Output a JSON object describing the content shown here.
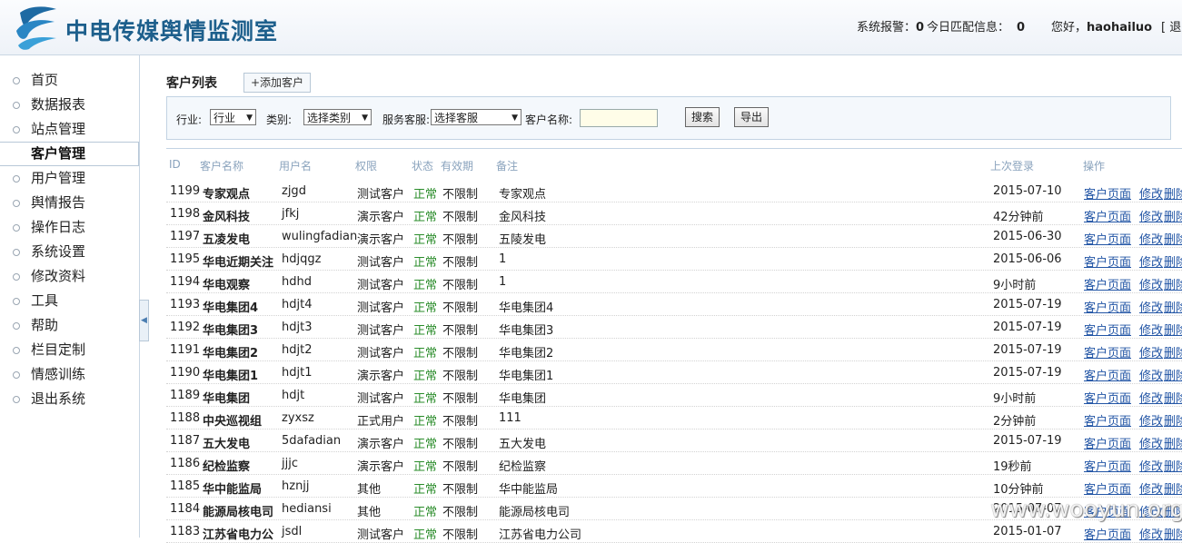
{
  "header": {
    "site_title": "中电传媒舆情监测室",
    "alarm_label": "系统报警：",
    "alarm_count": "0",
    "match_label": "今日匹配信息：",
    "match_count": "0",
    "greeting": "您好，",
    "username": "haohailuo",
    "logout_partial": "[ 退出"
  },
  "sidebar": {
    "items": [
      {
        "label": "首页"
      },
      {
        "label": "数据报表"
      },
      {
        "label": "站点管理"
      },
      {
        "label": "客户管理",
        "active": true
      },
      {
        "label": "用户管理"
      },
      {
        "label": "舆情报告"
      },
      {
        "label": "操作日志"
      },
      {
        "label": "系统设置"
      },
      {
        "label": "修改资料"
      },
      {
        "label": "工具"
      },
      {
        "label": "帮助"
      },
      {
        "label": "栏目定制"
      },
      {
        "label": "情感训练"
      },
      {
        "label": "退出系统"
      }
    ],
    "collapse_glyph": "◀"
  },
  "page": {
    "title": "客户列表",
    "add_button": "+添加客户"
  },
  "filter": {
    "industry_label": "行业:",
    "industry_value": "行业",
    "category_label": "类别:",
    "category_value": "选择类别",
    "service_label": "服务客服:",
    "service_value": "选择客服",
    "name_label": "客户名称:",
    "name_value": "",
    "search_button": "搜索",
    "export_button": "导出"
  },
  "table": {
    "headers": [
      "ID",
      "客户名称",
      "用户名",
      "权限",
      "状态",
      "有效期",
      "备注",
      "上次登录",
      "操作"
    ],
    "action_page": "客户页面",
    "action_edit": "修改",
    "action_delete": "删除",
    "rows": [
      {
        "id": "1199",
        "name": "专家观点",
        "user": "zjgd",
        "role": "测试客户",
        "status": "正常",
        "validity": "不限制",
        "note": "专家观点",
        "last": "2015-07-10"
      },
      {
        "id": "1198",
        "name": "金风科技",
        "user": "jfkj",
        "role": "演示客户",
        "status": "正常",
        "validity": "不限制",
        "note": "金风科技",
        "last": "42分钟前"
      },
      {
        "id": "1197",
        "name": "五凌发电",
        "user": "wulingfadian",
        "role": "演示客户",
        "status": "正常",
        "validity": "不限制",
        "note": "五陵发电",
        "last": "2015-06-30"
      },
      {
        "id": "1195",
        "name": "华电近期关注",
        "user": "hdjqgz",
        "role": "测试客户",
        "status": "正常",
        "validity": "不限制",
        "note": "1",
        "last": "2015-06-06"
      },
      {
        "id": "1194",
        "name": "华电观察",
        "user": "hdhd",
        "role": "测试客户",
        "status": "正常",
        "validity": "不限制",
        "note": "1",
        "last": "9小时前"
      },
      {
        "id": "1193",
        "name": "华电集团4",
        "user": "hdjt4",
        "role": "测试客户",
        "status": "正常",
        "validity": "不限制",
        "note": "华电集团4",
        "last": "2015-07-19"
      },
      {
        "id": "1192",
        "name": "华电集团3",
        "user": "hdjt3",
        "role": "测试客户",
        "status": "正常",
        "validity": "不限制",
        "note": "华电集团3",
        "last": "2015-07-19"
      },
      {
        "id": "1191",
        "name": "华电集团2",
        "user": "hdjt2",
        "role": "测试客户",
        "status": "正常",
        "validity": "不限制",
        "note": "华电集团2",
        "last": "2015-07-19"
      },
      {
        "id": "1190",
        "name": "华电集团1",
        "user": "hdjt1",
        "role": "演示客户",
        "status": "正常",
        "validity": "不限制",
        "note": "华电集团1",
        "last": "2015-07-19"
      },
      {
        "id": "1189",
        "name": "华电集团",
        "user": "hdjt",
        "role": "测试客户",
        "status": "正常",
        "validity": "不限制",
        "note": "华电集团",
        "last": "9小时前"
      },
      {
        "id": "1188",
        "name": "中央巡视组",
        "user": "zyxsz",
        "role": "正式用户",
        "status": "正常",
        "validity": "不限制",
        "note": "111",
        "last": "2分钟前"
      },
      {
        "id": "1187",
        "name": "五大发电",
        "user": "5dafadian",
        "role": "演示客户",
        "status": "正常",
        "validity": "不限制",
        "note": "五大发电",
        "last": "2015-07-19"
      },
      {
        "id": "1186",
        "name": "纪检监察",
        "user": "jjjc",
        "role": "演示客户",
        "status": "正常",
        "validity": "不限制",
        "note": "纪检监察",
        "last": "19秒前"
      },
      {
        "id": "1185",
        "name": "华中能监局",
        "user": "hznjj",
        "role": "其他",
        "status": "正常",
        "validity": "不限制",
        "note": "华中能监局",
        "last": "10分钟前"
      },
      {
        "id": "1184",
        "name": "能源局核电司",
        "user": "hediansi",
        "role": "其他",
        "status": "正常",
        "validity": "不限制",
        "note": "能源局核电司",
        "last": "2015-07-07"
      },
      {
        "id": "1183",
        "name": "江苏省电力公",
        "user": "jsdl",
        "role": "测试客户",
        "status": "正常",
        "validity": "不限制",
        "note": "江苏省电力公司",
        "last": "2015-01-07"
      }
    ]
  },
  "watermark": "www.wooyun.org",
  "colors": {
    "status_ok": "#2a8c2a",
    "link": "#2255a5",
    "header_text": "#8aa3bd",
    "brand": "#1d5f8c"
  }
}
